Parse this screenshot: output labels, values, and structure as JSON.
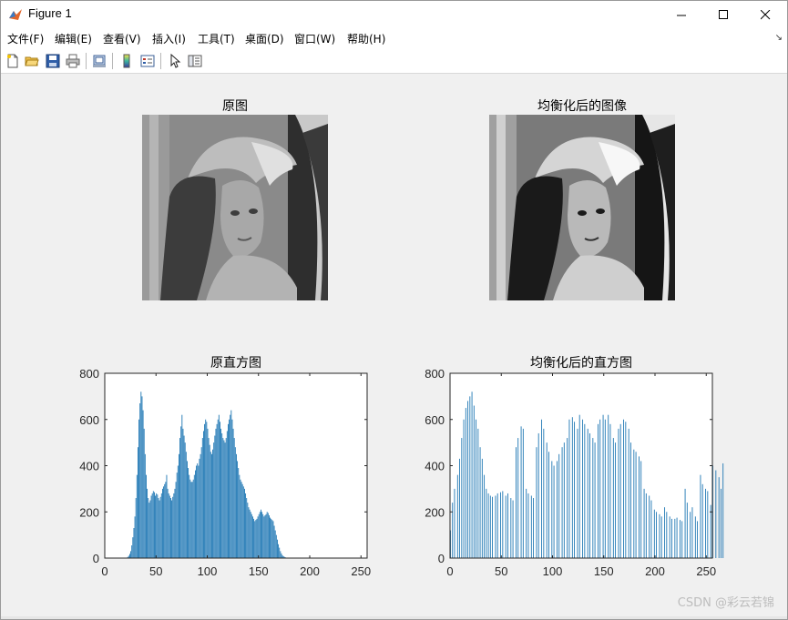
{
  "window": {
    "title": "Figure 1"
  },
  "menu": {
    "items": [
      {
        "label": "文件(F)"
      },
      {
        "label": "编辑(E)"
      },
      {
        "label": "查看(V)"
      },
      {
        "label": "插入(I)"
      },
      {
        "label": "工具(T)"
      },
      {
        "label": "桌面(D)"
      },
      {
        "label": "窗口(W)"
      },
      {
        "label": "帮助(H)"
      }
    ]
  },
  "toolbar": {
    "icons": [
      "new-figure-icon",
      "open-file-icon",
      "save-icon",
      "print-icon",
      "print-preview-icon",
      "colorbar-icon",
      "legend-icon",
      "pointer-icon",
      "property-editor-icon"
    ]
  },
  "subplots": {
    "original_image_title": "原图",
    "equalized_image_title": "均衡化后的图像",
    "original_hist_title": "原直方图",
    "equalized_hist_title": "均衡化后的直方图"
  },
  "watermark": "CSDN @彩云若锦",
  "colors": {
    "bar": "#1f77b4",
    "figure_bg": "#f0f0f0",
    "axes_bg": "#ffffff"
  },
  "chart_data": [
    {
      "type": "bar",
      "title": "原直方图",
      "xlim": [
        0,
        256
      ],
      "ylim": [
        0,
        800
      ],
      "xticks": [
        0,
        50,
        100,
        150,
        200,
        250
      ],
      "yticks": [
        0,
        200,
        400,
        600,
        800
      ],
      "x_start": 0,
      "values": [
        0,
        0,
        0,
        0,
        0,
        0,
        0,
        0,
        0,
        0,
        0,
        0,
        0,
        0,
        0,
        0,
        0,
        0,
        0,
        0,
        0,
        0,
        5,
        10,
        18,
        30,
        55,
        90,
        130,
        180,
        260,
        360,
        480,
        600,
        670,
        720,
        700,
        640,
        560,
        450,
        360,
        300,
        260,
        240,
        250,
        270,
        280,
        290,
        285,
        270,
        280,
        275,
        260,
        250,
        265,
        280,
        300,
        310,
        320,
        330,
        360,
        300,
        280,
        270,
        260,
        250,
        265,
        280,
        300,
        330,
        370,
        400,
        450,
        520,
        570,
        620,
        560,
        530,
        500,
        460,
        420,
        390,
        360,
        340,
        330,
        330,
        340,
        360,
        380,
        400,
        410,
        400,
        430,
        450,
        480,
        520,
        550,
        580,
        600,
        590,
        560,
        520,
        490,
        460,
        450,
        470,
        500,
        530,
        560,
        580,
        600,
        620,
        590,
        560,
        540,
        520,
        510,
        500,
        520,
        550,
        580,
        600,
        620,
        640,
        600,
        560,
        520,
        480,
        450,
        420,
        390,
        360,
        340,
        330,
        320,
        310,
        300,
        280,
        260,
        240,
        220,
        210,
        200,
        190,
        180,
        170,
        160,
        165,
        170,
        180,
        190,
        200,
        210,
        200,
        190,
        180,
        185,
        190,
        200,
        195,
        185,
        175,
        170,
        165,
        160,
        140,
        120,
        100,
        80,
        60,
        45,
        30,
        20,
        12,
        8,
        5,
        3,
        2,
        1,
        0,
        0,
        0,
        0,
        0,
        0,
        0,
        0,
        0,
        0,
        0,
        0,
        0,
        0,
        0,
        0,
        0,
        0,
        0,
        0,
        0,
        0,
        0,
        0,
        0,
        0,
        0,
        0,
        0,
        0,
        0,
        0,
        0,
        0,
        0,
        0,
        0,
        0,
        0,
        0,
        0,
        0,
        0,
        0,
        0,
        0,
        0,
        0,
        0,
        0,
        0,
        0,
        0,
        0,
        0,
        0,
        0,
        0,
        0,
        0,
        0,
        0,
        0,
        0,
        0,
        0,
        0,
        0,
        0,
        0,
        0,
        0,
        0,
        0
      ]
    },
    {
      "type": "bar",
      "title": "均衡化后的直方图",
      "xlim": [
        0,
        256
      ],
      "ylim": [
        0,
        800
      ],
      "xticks": [
        0,
        50,
        100,
        150,
        200,
        250
      ],
      "yticks": [
        0,
        200,
        400,
        600,
        800
      ],
      "x_start": 0,
      "values": [
        120,
        0,
        240,
        0,
        300,
        0,
        0,
        360,
        0,
        430,
        0,
        520,
        0,
        600,
        0,
        650,
        0,
        680,
        0,
        700,
        0,
        720,
        0,
        660,
        0,
        600,
        0,
        560,
        0,
        480,
        0,
        430,
        0,
        360,
        0,
        300,
        0,
        280,
        0,
        270,
        0,
        265,
        0,
        0,
        270,
        0,
        280,
        0,
        0,
        285,
        0,
        290,
        0,
        0,
        270,
        0,
        280,
        0,
        0,
        260,
        0,
        250,
        0,
        0,
        480,
        0,
        520,
        0,
        0,
        570,
        0,
        560,
        0,
        0,
        300,
        0,
        280,
        0,
        0,
        270,
        0,
        260,
        0,
        0,
        480,
        0,
        540,
        0,
        0,
        600,
        0,
        560,
        0,
        0,
        500,
        0,
        460,
        0,
        0,
        420,
        0,
        400,
        0,
        0,
        420,
        0,
        450,
        0,
        0,
        480,
        0,
        500,
        0,
        0,
        520,
        0,
        600,
        0,
        0,
        610,
        0,
        590,
        0,
        0,
        560,
        0,
        620,
        0,
        0,
        600,
        0,
        580,
        0,
        0,
        560,
        0,
        540,
        0,
        0,
        520,
        0,
        500,
        0,
        0,
        580,
        0,
        600,
        0,
        0,
        620,
        0,
        600,
        0,
        0,
        620,
        0,
        580,
        0,
        0,
        520,
        0,
        500,
        0,
        0,
        560,
        0,
        580,
        0,
        0,
        600,
        0,
        590,
        0,
        0,
        560,
        0,
        500,
        0,
        0,
        470,
        0,
        460,
        0,
        0,
        440,
        0,
        420,
        0,
        0,
        300,
        0,
        280,
        0,
        0,
        270,
        0,
        250,
        0,
        0,
        210,
        0,
        200,
        0,
        0,
        190,
        0,
        180,
        0,
        0,
        220,
        0,
        200,
        0,
        0,
        180,
        0,
        170,
        0,
        0,
        170,
        0,
        175,
        0,
        0,
        165,
        0,
        160,
        0,
        0,
        300,
        0,
        240,
        0,
        0,
        200,
        0,
        220,
        0,
        0,
        180,
        0,
        160,
        0,
        0,
        360,
        0,
        320,
        0,
        0,
        300,
        0,
        290,
        0,
        0,
        230,
        0,
        400,
        0,
        0,
        380,
        0,
        0,
        350,
        0,
        300,
        0,
        410,
        0,
        0
      ]
    }
  ]
}
